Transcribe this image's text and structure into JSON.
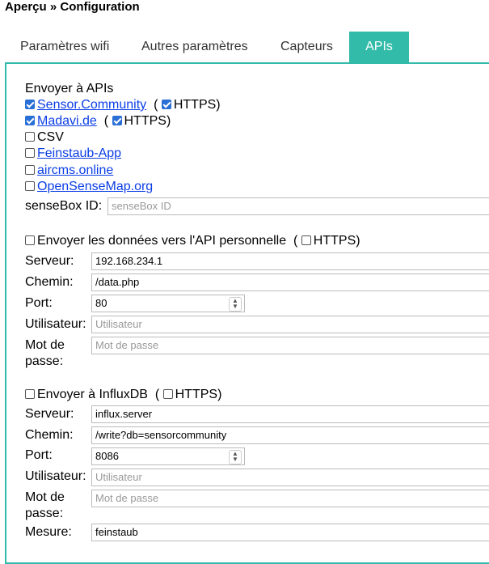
{
  "breadcrumb": "Aperçu » Configuration",
  "tabs": [
    "Paramètres wifi",
    "Autres paramètres",
    "Capteurs",
    "APIs"
  ],
  "apis": {
    "heading": "Envoyer à APIs",
    "sensor_community": "Sensor.Community",
    "https": "HTTPS)",
    "open_paren": "(",
    "madavi": "Madavi.de",
    "csv": "CSV",
    "feinstaub": "Feinstaub-App",
    "aircms": "aircms.online",
    "opensensemap": "OpenSenseMap.org",
    "sensebox_label": "senseBox ID:",
    "sensebox_placeholder": "senseBox ID"
  },
  "custom": {
    "checkbox_label": "Envoyer les données vers l'API personnelle",
    "server_label": "Serveur:",
    "server_value": "192.168.234.1",
    "path_label": "Chemin:",
    "path_value": "/data.php",
    "port_label": "Port:",
    "port_value": "80",
    "user_label": "Utilisateur:",
    "user_placeholder": "Utilisateur",
    "pass_label_1": "Mot de",
    "pass_label_2": "passe:",
    "pass_placeholder": "Mot de passe"
  },
  "influx": {
    "checkbox_label": "Envoyer à InfluxDB",
    "server_label": "Serveur:",
    "server_value": "influx.server",
    "path_label": "Chemin:",
    "path_value": "/write?db=sensorcommunity",
    "port_label": "Port:",
    "port_value": "8086",
    "user_label": "Utilisateur:",
    "user_placeholder": "Utilisateur",
    "pass_label_1": "Mot de",
    "pass_label_2": "passe:",
    "pass_placeholder": "Mot de passe",
    "measure_label": "Mesure:",
    "measure_value": "feinstaub"
  },
  "colors": {
    "accent": "#33bbaa",
    "link": "#0b3ee6",
    "checked": "#2a6fd6"
  }
}
